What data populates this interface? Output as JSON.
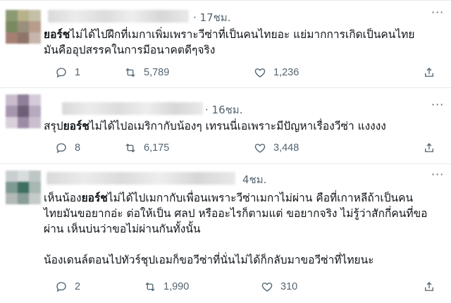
{
  "tweets": [
    {
      "time": "· 17ชม.",
      "lines": [
        {
          "bold": "ยอร์ช",
          "rest": "ไม่ได้ไปฝึกที่เมกาเพิ่มเพราะวีซ่าที่เป็นคนไทยอะ แย่มากการเกิดเป็นคนไทย"
        },
        {
          "bold": "",
          "rest": "มันคืออุปสรรคในการมีอนาคตดีๆจริง"
        }
      ],
      "replies": "1",
      "retweets": "5,789",
      "likes": "1,236"
    },
    {
      "time": "· 16ชม.",
      "lines": [
        {
          "bold": "",
          "pre": "สรุป",
          "boldmid": "ยอร์ช",
          "rest": "ไม่ได้ไปอเมริกากับน้องๆ เทรนนี่เอเพราะมีปัญหาเรื่องวีซ่า แงงงง"
        }
      ],
      "replies": "8",
      "retweets": "6,175",
      "likes": "3,448"
    },
    {
      "time": "4ชม.",
      "lines": [
        {
          "pre": "เห็นน้อง",
          "boldmid": "ยอร์ช",
          "rest": "ไม่ได้ไปเมกากับเพื่อนเพราะวีซ่าเมกาไม่ผ่าน คือที่เกาหลีถ้าเป็นคน"
        },
        {
          "pre": "",
          "boldmid": "",
          "rest": "ไทยมันขอยากอ่ะ ต่อให้เป็น ศลป หรืออะไรก็ตามแต่ ขอยากจริง ไม่รู้ว่าสักกี่คนที่ขอ"
        },
        {
          "pre": "",
          "boldmid": "",
          "rest": "ผ่าน เห็นบ่นว่าขอไม่ผ่านกันทั้งนั้น"
        },
        {
          "pre": "",
          "boldmid": "",
          "rest": ""
        },
        {
          "pre": "",
          "boldmid": "",
          "rest": "น้องเดนล์ตอนไปทัวร์ชุปเอมก็ขอวีซ่าที่นั่นไม่ได้ก็กลับมาขอวีซ่าที่ไทยนะ"
        }
      ],
      "replies": "2",
      "retweets": "1,990",
      "likes": "310"
    }
  ],
  "icons": {
    "reply": "reply-icon",
    "retweet": "retweet-icon",
    "like": "heart-icon",
    "share": "share-icon",
    "more": "more-icon"
  },
  "colors": {
    "text": "#0f1419",
    "secondary": "#536471",
    "divider": "#e6e9eb"
  }
}
